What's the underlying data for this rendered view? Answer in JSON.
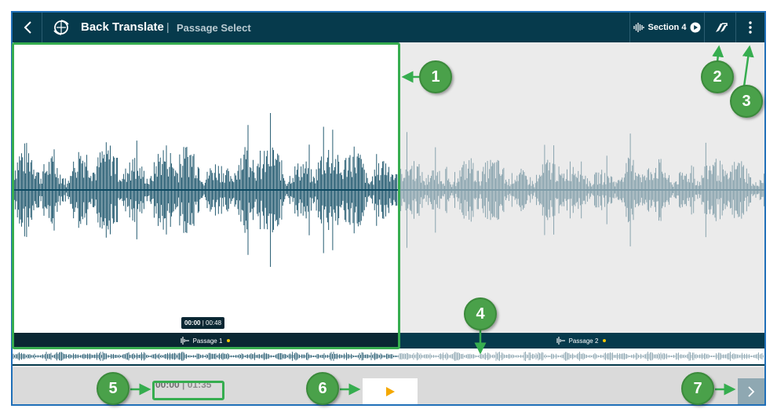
{
  "header": {
    "title": "Back Translate",
    "separator": "|",
    "subtitle": "Passage Select",
    "section_label": "Section 4",
    "icons": [
      "chevron-left-icon",
      "app-globe-icon",
      "waveform-icon",
      "play-circle-icon",
      "navigate-icon",
      "more-vertical-icon"
    ]
  },
  "passages": [
    {
      "label": "Passage 1",
      "selected": true,
      "tooltip_current": "00:00",
      "tooltip_separator": "|",
      "tooltip_duration": "00:48"
    },
    {
      "label": "Passage 2",
      "selected": false
    }
  ],
  "player": {
    "current": "00:00",
    "separator": "|",
    "total": "01:35"
  },
  "callouts": [
    "1",
    "2",
    "3",
    "4",
    "5",
    "6",
    "7"
  ],
  "colors": {
    "header_bg": "#063a4c",
    "selected_wave": "#0e4a62",
    "unselected_wave": "#7f9ca8",
    "annotation_green": "#36ad4f",
    "status_dot": "#f2c500"
  }
}
